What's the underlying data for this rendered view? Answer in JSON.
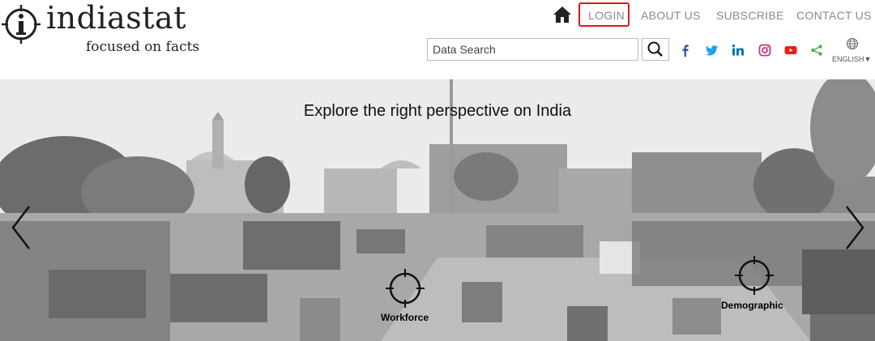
{
  "brand": {
    "name": "indiastat",
    "tagline": "focused on facts"
  },
  "nav": {
    "login": "LOGIN",
    "about": "ABOUT US",
    "subscribe": "SUBSCRIBE",
    "contact": "CONTACT US"
  },
  "search": {
    "placeholder": "Data Search",
    "value": ""
  },
  "social": [
    "facebook",
    "twitter",
    "linkedin",
    "instagram",
    "youtube",
    "share"
  ],
  "language": {
    "label": "ENGLISH▼"
  },
  "hero": {
    "title": "Explore the right perspective on India",
    "badges": [
      {
        "label": "Workforce"
      },
      {
        "label": "Demographic"
      }
    ]
  },
  "colors": {
    "login_highlight": "#e0161c",
    "nav_text": "#8a8a8a",
    "facebook": "#3b5998",
    "twitter": "#1da1f2",
    "linkedin": "#0077b5",
    "instagram": "#c13584",
    "youtube": "#e62117",
    "share": "#4caf50"
  }
}
